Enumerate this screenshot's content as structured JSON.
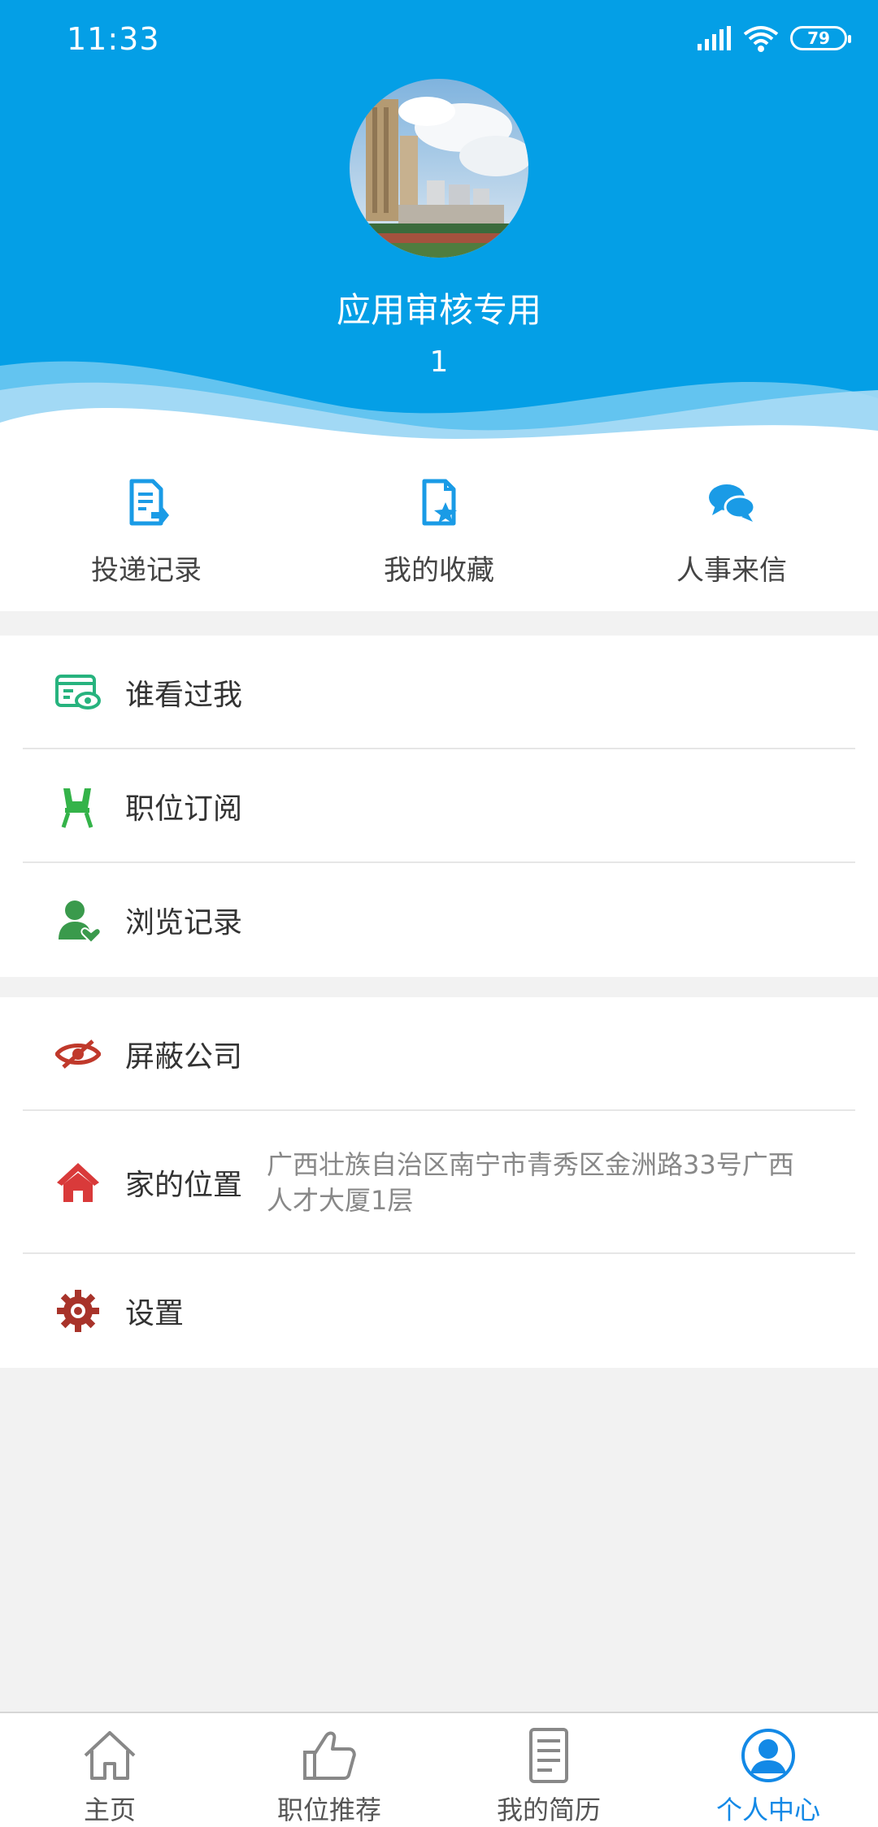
{
  "status_bar": {
    "time": "11:33",
    "battery": "79"
  },
  "profile": {
    "name": "应用审核专用",
    "id": "1"
  },
  "quick_actions": [
    {
      "label": "投递记录",
      "icon": "delivery-record-icon"
    },
    {
      "label": "我的收藏",
      "icon": "favorite-doc-icon"
    },
    {
      "label": "人事来信",
      "icon": "chat-bubbles-icon"
    }
  ],
  "menu_group1": [
    {
      "label": "谁看过我",
      "icon": "viewed-card-eye-icon",
      "color": "#27b37e"
    },
    {
      "label": "职位订阅",
      "icon": "subscribe-chair-icon",
      "color": "#34b349"
    },
    {
      "label": "浏览记录",
      "icon": "user-heart-icon",
      "color": "#3a9a4c"
    }
  ],
  "menu_group2": [
    {
      "label": "屏蔽公司",
      "icon": "hide-eye-icon",
      "color": "#c0392b"
    },
    {
      "label": "家的位置",
      "value": "广西壮族自治区南宁市青秀区金洲路33号广西人才大厦1层",
      "icon": "home-icon",
      "color": "#d93a3a"
    },
    {
      "label": "设置",
      "icon": "gear-icon",
      "color": "#a8332a"
    }
  ],
  "bottom_nav": [
    {
      "label": "主页",
      "icon": "home-outline-icon"
    },
    {
      "label": "职位推荐",
      "icon": "thumbs-up-icon"
    },
    {
      "label": "我的简历",
      "icon": "resume-icon"
    },
    {
      "label": "个人中心",
      "icon": "person-circle-icon",
      "active": true
    }
  ],
  "colors": {
    "header_blue": "#049fe6",
    "accent": "#1389e6"
  }
}
